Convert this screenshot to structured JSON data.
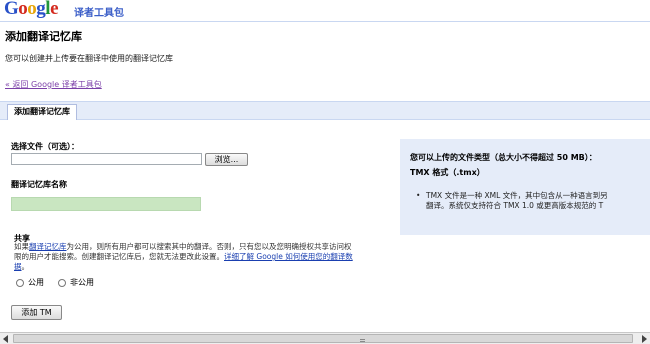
{
  "header": {
    "logo": {
      "g1": "G",
      "o1": "o",
      "o2": "o",
      "g2": "g",
      "l": "l",
      "e": "e"
    },
    "product": "译者工具包"
  },
  "page": {
    "title": "添加翻译记忆库",
    "subtitle": "您可以创建并上传要在翻译中使用的翻译记忆库",
    "back_link": "« 返回 Google 译者工具包"
  },
  "tabs": [
    {
      "label": "添加翻译记忆库"
    }
  ],
  "form": {
    "file_label": "选择文件（可选）：",
    "file_value": "",
    "browse_label": "浏览...",
    "name_label": "翻译记忆库名称",
    "name_value": ""
  },
  "share": {
    "title": "共享",
    "desc_1": "如果",
    "desc_link": "翻译记忆库",
    "desc_2": "为公用，则所有用户都可以搜索其中的翻译。否则，只有您以及您明确授权共享访问权限的用户才能搜索。创建翻译记忆库后，您就无法更改此设置。",
    "learn_more": "详细了解 Google 如何使用您的翻译数据",
    "desc_end": "。",
    "options": [
      {
        "label": "公用"
      },
      {
        "label": "非公用"
      }
    ]
  },
  "add_button": "添加 TM",
  "info": {
    "title": "您可以上传的文件类型（总大小不得超过 50 MB）：",
    "subtitle": "TMX 格式（.tmx）",
    "bullet_line1": "TMX 文件是一种 XML 文件，其中包含从一种语言到另",
    "bullet_line2": "翻译。系统仅支持符合 TMX 1.0 或更高版本规范的 T"
  }
}
